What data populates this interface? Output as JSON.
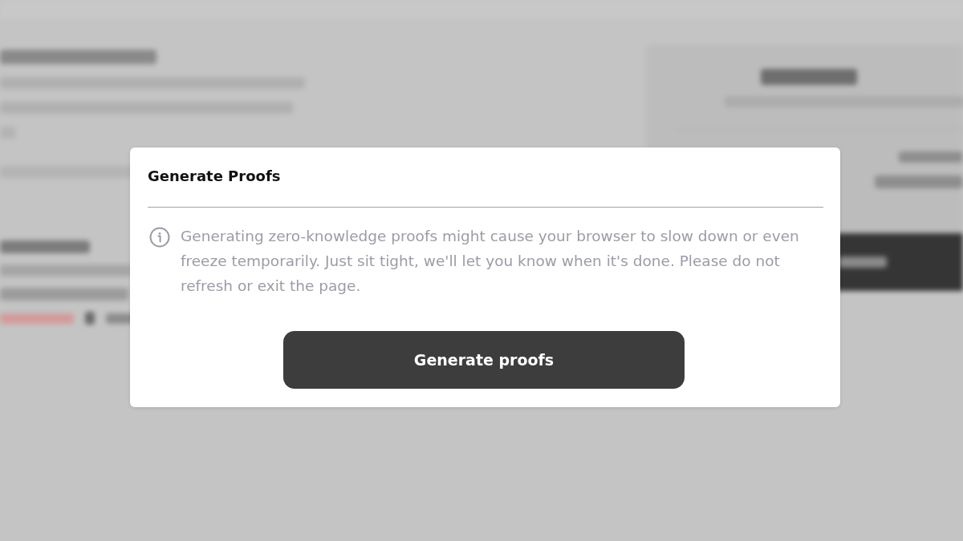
{
  "dialog": {
    "title": "Generate Proofs",
    "message": "Generating zero-knowledge proofs might cause your browser to slow down or even freeze temporarily. Just sit tight, we'll let you know when it's done. Please do not refresh or exit the page.",
    "button": "Generate proofs"
  }
}
